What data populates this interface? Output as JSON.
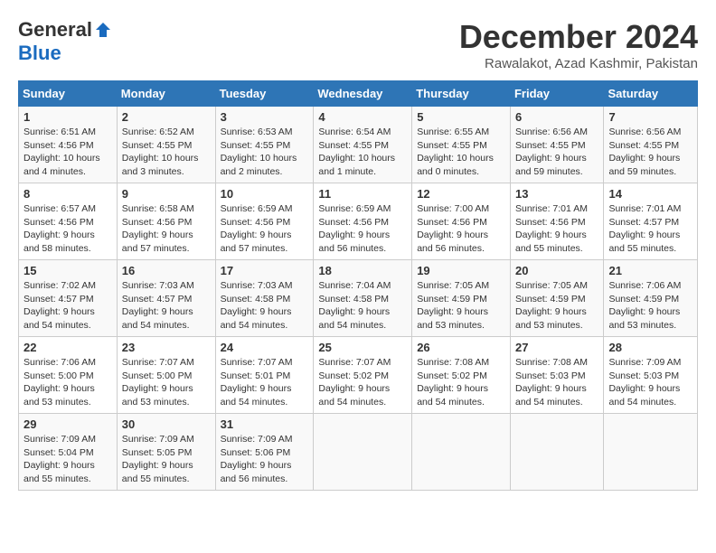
{
  "header": {
    "logo_general": "General",
    "logo_blue": "Blue",
    "month_title": "December 2024",
    "location": "Rawalakot, Azad Kashmir, Pakistan"
  },
  "weekdays": [
    "Sunday",
    "Monday",
    "Tuesday",
    "Wednesday",
    "Thursday",
    "Friday",
    "Saturday"
  ],
  "weeks": [
    [
      {
        "day": "1",
        "sunrise": "6:51 AM",
        "sunset": "4:56 PM",
        "daylight": "10 hours and 4 minutes."
      },
      {
        "day": "2",
        "sunrise": "6:52 AM",
        "sunset": "4:55 PM",
        "daylight": "10 hours and 3 minutes."
      },
      {
        "day": "3",
        "sunrise": "6:53 AM",
        "sunset": "4:55 PM",
        "daylight": "10 hours and 2 minutes."
      },
      {
        "day": "4",
        "sunrise": "6:54 AM",
        "sunset": "4:55 PM",
        "daylight": "10 hours and 1 minute."
      },
      {
        "day": "5",
        "sunrise": "6:55 AM",
        "sunset": "4:55 PM",
        "daylight": "10 hours and 0 minutes."
      },
      {
        "day": "6",
        "sunrise": "6:56 AM",
        "sunset": "4:55 PM",
        "daylight": "9 hours and 59 minutes."
      },
      {
        "day": "7",
        "sunrise": "6:56 AM",
        "sunset": "4:55 PM",
        "daylight": "9 hours and 59 minutes."
      }
    ],
    [
      {
        "day": "8",
        "sunrise": "6:57 AM",
        "sunset": "4:56 PM",
        "daylight": "9 hours and 58 minutes."
      },
      {
        "day": "9",
        "sunrise": "6:58 AM",
        "sunset": "4:56 PM",
        "daylight": "9 hours and 57 minutes."
      },
      {
        "day": "10",
        "sunrise": "6:59 AM",
        "sunset": "4:56 PM",
        "daylight": "9 hours and 57 minutes."
      },
      {
        "day": "11",
        "sunrise": "6:59 AM",
        "sunset": "4:56 PM",
        "daylight": "9 hours and 56 minutes."
      },
      {
        "day": "12",
        "sunrise": "7:00 AM",
        "sunset": "4:56 PM",
        "daylight": "9 hours and 56 minutes."
      },
      {
        "day": "13",
        "sunrise": "7:01 AM",
        "sunset": "4:56 PM",
        "daylight": "9 hours and 55 minutes."
      },
      {
        "day": "14",
        "sunrise": "7:01 AM",
        "sunset": "4:57 PM",
        "daylight": "9 hours and 55 minutes."
      }
    ],
    [
      {
        "day": "15",
        "sunrise": "7:02 AM",
        "sunset": "4:57 PM",
        "daylight": "9 hours and 54 minutes."
      },
      {
        "day": "16",
        "sunrise": "7:03 AM",
        "sunset": "4:57 PM",
        "daylight": "9 hours and 54 minutes."
      },
      {
        "day": "17",
        "sunrise": "7:03 AM",
        "sunset": "4:58 PM",
        "daylight": "9 hours and 54 minutes."
      },
      {
        "day": "18",
        "sunrise": "7:04 AM",
        "sunset": "4:58 PM",
        "daylight": "9 hours and 54 minutes."
      },
      {
        "day": "19",
        "sunrise": "7:05 AM",
        "sunset": "4:59 PM",
        "daylight": "9 hours and 53 minutes."
      },
      {
        "day": "20",
        "sunrise": "7:05 AM",
        "sunset": "4:59 PM",
        "daylight": "9 hours and 53 minutes."
      },
      {
        "day": "21",
        "sunrise": "7:06 AM",
        "sunset": "4:59 PM",
        "daylight": "9 hours and 53 minutes."
      }
    ],
    [
      {
        "day": "22",
        "sunrise": "7:06 AM",
        "sunset": "5:00 PM",
        "daylight": "9 hours and 53 minutes."
      },
      {
        "day": "23",
        "sunrise": "7:07 AM",
        "sunset": "5:00 PM",
        "daylight": "9 hours and 53 minutes."
      },
      {
        "day": "24",
        "sunrise": "7:07 AM",
        "sunset": "5:01 PM",
        "daylight": "9 hours and 54 minutes."
      },
      {
        "day": "25",
        "sunrise": "7:07 AM",
        "sunset": "5:02 PM",
        "daylight": "9 hours and 54 minutes."
      },
      {
        "day": "26",
        "sunrise": "7:08 AM",
        "sunset": "5:02 PM",
        "daylight": "9 hours and 54 minutes."
      },
      {
        "day": "27",
        "sunrise": "7:08 AM",
        "sunset": "5:03 PM",
        "daylight": "9 hours and 54 minutes."
      },
      {
        "day": "28",
        "sunrise": "7:09 AM",
        "sunset": "5:03 PM",
        "daylight": "9 hours and 54 minutes."
      }
    ],
    [
      {
        "day": "29",
        "sunrise": "7:09 AM",
        "sunset": "5:04 PM",
        "daylight": "9 hours and 55 minutes."
      },
      {
        "day": "30",
        "sunrise": "7:09 AM",
        "sunset": "5:05 PM",
        "daylight": "9 hours and 55 minutes."
      },
      {
        "day": "31",
        "sunrise": "7:09 AM",
        "sunset": "5:06 PM",
        "daylight": "9 hours and 56 minutes."
      },
      null,
      null,
      null,
      null
    ]
  ],
  "labels": {
    "sunrise": "Sunrise:",
    "sunset": "Sunset:",
    "daylight": "Daylight hours"
  }
}
